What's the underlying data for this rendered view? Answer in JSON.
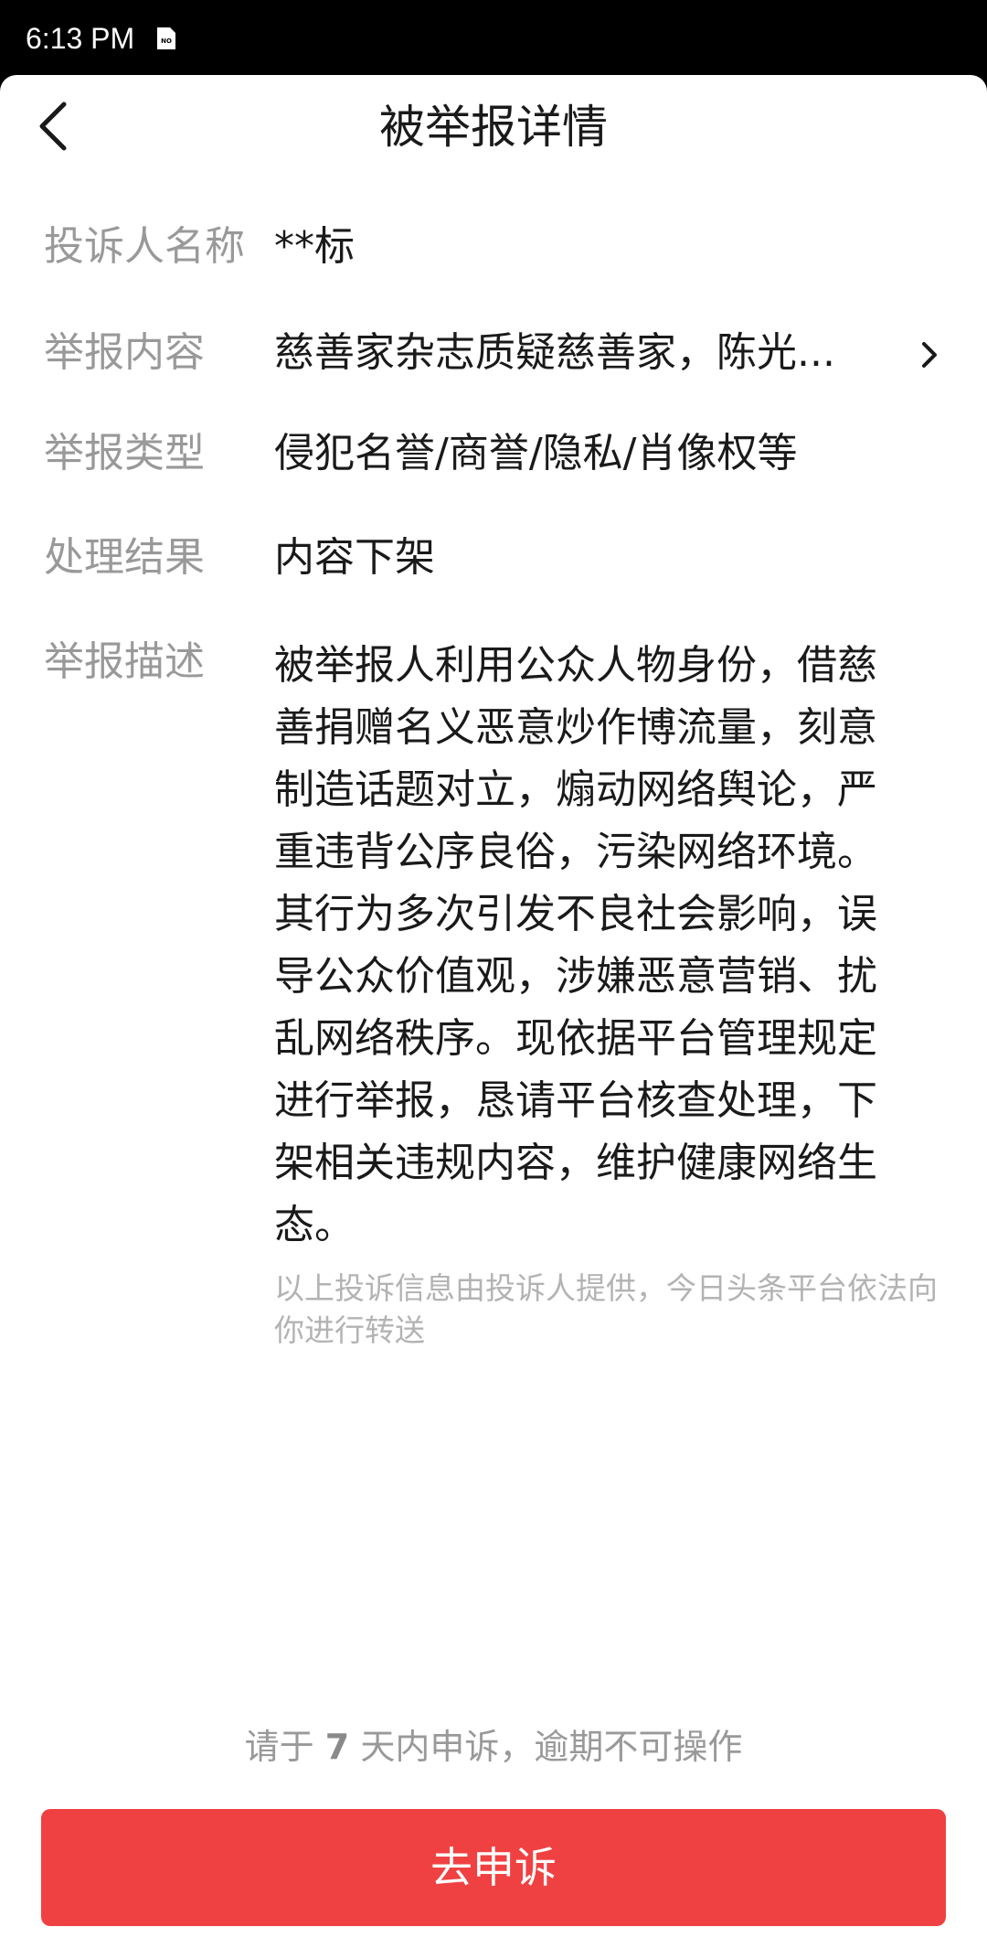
{
  "status_bar": {
    "time": "6:13 PM",
    "sim_label": "NO"
  },
  "header": {
    "title": "被举报详情",
    "back_icon": "chevron-left-icon"
  },
  "details": {
    "complainant_label": "投诉人名称",
    "complainant_value": "**标",
    "content_label": "举报内容",
    "content_value": "慈善家杂志质疑慈善家，陈光...",
    "content_icon": "chevron-right-icon",
    "type_label": "举报类型",
    "type_value": "侵犯名誉/商誉/隐私/肖像权等",
    "result_label": "处理结果",
    "result_value": "内容下架",
    "description_label": "举报描述",
    "description_value": "被举报人利用公众人物身份，借慈善捐赠名义恶意炒作博流量，刻意制造话题对立，煽动网络舆论，严重违背公序良俗，污染网络环境。其行为多次引发不良社会影响，误导公众价值观，涉嫌恶意营销、扰乱网络秩序。现依据平台管理规定进行举报，恳请平台核查处理，下架相关违规内容，维护健康网络生态。",
    "disclaimer": "以上投诉信息由投诉人提供，今日头条平台依法向你进行转送"
  },
  "footer": {
    "deadline_prefix": "请于",
    "deadline_days": "7",
    "deadline_suffix": "天内申诉，逾期不可操作",
    "appeal_button": "去申诉"
  },
  "colors": {
    "accent": "#f04142",
    "label_gray": "#999999",
    "text": "#1a1a1a",
    "disclaimer_gray": "#b3b3b3"
  }
}
